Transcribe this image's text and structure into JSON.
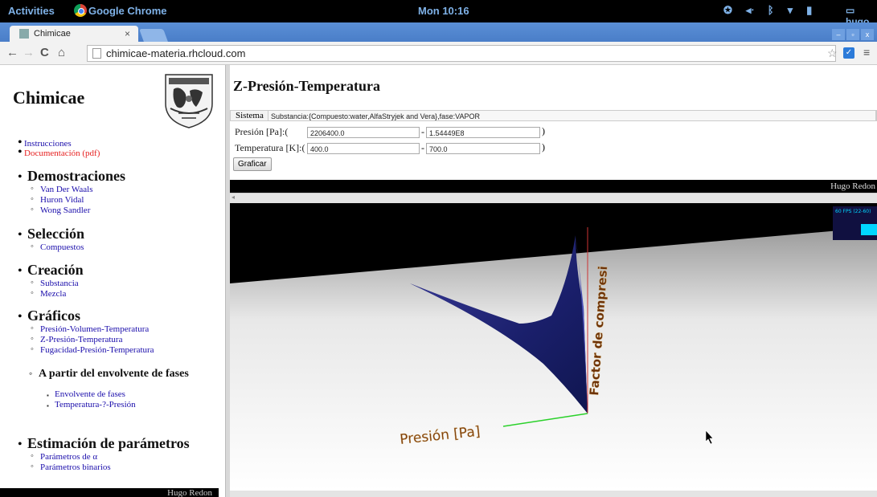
{
  "topbar": {
    "activities": "Activities",
    "app_menu": "Google Chrome",
    "clock": "Mon 10:16",
    "user": "hugo"
  },
  "browser": {
    "tab_title": "Chimicae",
    "tab_close": "×",
    "url": "chimicae-materia.rhcloud.com"
  },
  "sidebar": {
    "site_title": "Chimicae",
    "top_links": [
      {
        "label": "Instrucciones"
      },
      {
        "label": "Documentación (pdf)"
      }
    ],
    "sections": [
      {
        "heading": "Demostraciones",
        "items": [
          "Van Der Waals",
          "Huron Vidal",
          "Wong Sandler"
        ]
      },
      {
        "heading": "Selección",
        "items": [
          "Compuestos"
        ]
      },
      {
        "heading": "Creación",
        "items": [
          "Substancia",
          "Mezcla"
        ]
      },
      {
        "heading": "Gráficos",
        "items": [
          "Presión-Volumen-Temperatura",
          "Z-Presión-Temperatura",
          "Fugacidad-Presión-Temperatura"
        ]
      },
      {
        "heading": "Estimación de parámetros",
        "items": [
          "Parámetros de α",
          "Parámetros binarios"
        ]
      }
    ],
    "subsection": {
      "heading": "A partir del envolvente de fases",
      "items": [
        "Envolvente de fases",
        "Temperatura-?-Presión"
      ]
    },
    "footer": "Hugo Redon"
  },
  "main": {
    "title": "Z-Presión-Temperatura",
    "sistema_label": "Sistema",
    "sistema_value": "Substancia:{Compuesto:water,AlfaStryjek and Vera},fase:VAPOR",
    "presion_label": "Presión [Pa]:(",
    "presion_min": "2206400.0",
    "presion_max": "1.54449E8",
    "temperatura_label": "Temperatura [K]:(",
    "temperatura_min": "400.0",
    "temperatura_max": "700.0",
    "dash": "-",
    "close_paren": ")",
    "graficar_button": "Graficar",
    "footer": "Hugo Redon"
  },
  "plot3d": {
    "axis_label_x": "Presión [Pa]",
    "axis_label_z": "Factor de compresi",
    "fps_label": "60 FPS (22-60)"
  }
}
